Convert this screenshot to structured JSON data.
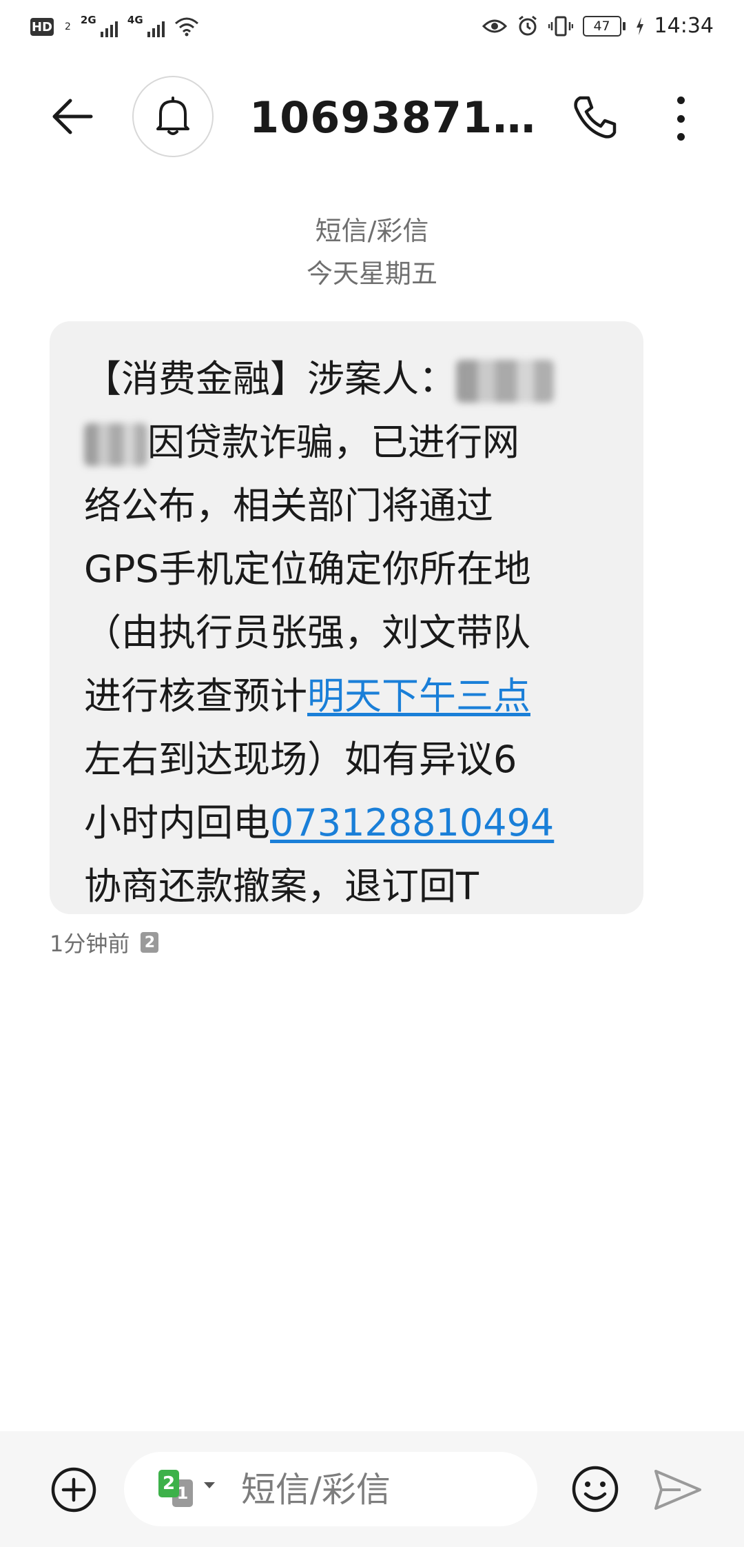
{
  "status_bar": {
    "hd": "HD",
    "hd_sub": "2",
    "net1": "2G",
    "net2": "4G",
    "battery": "47",
    "time": "14:34"
  },
  "header": {
    "contact": "10693871…",
    "icons": [
      "back-arrow-icon",
      "bell-icon",
      "phone-icon",
      "more-vertical-icon"
    ]
  },
  "thread": {
    "type": "短信/彩信",
    "date": "今天星期五"
  },
  "message": {
    "lines": [
      "【消费金融】涉案人：",
      "因贷款诈骗，已进行网",
      "络公布，相关部门将通过",
      "GPS手机定位确定你所在地",
      "（由执行员张强，刘文带队",
      "进行核查预计",
      "明天下午三点",
      "左右到达现场）如有异议6",
      "小时内回电",
      "073128810494",
      "协商还款撤案，退订回T"
    ],
    "time": "1分钟前",
    "sim": "2"
  },
  "composer": {
    "placeholder": "短信/彩信",
    "sim_primary": "2",
    "sim_secondary": "1",
    "icons": [
      "add-circle-icon",
      "emoji-icon",
      "send-icon"
    ]
  },
  "colors": {
    "link": "#1a7fd8",
    "bubble": "#f1f1f1",
    "sim_green": "#3db14a"
  }
}
